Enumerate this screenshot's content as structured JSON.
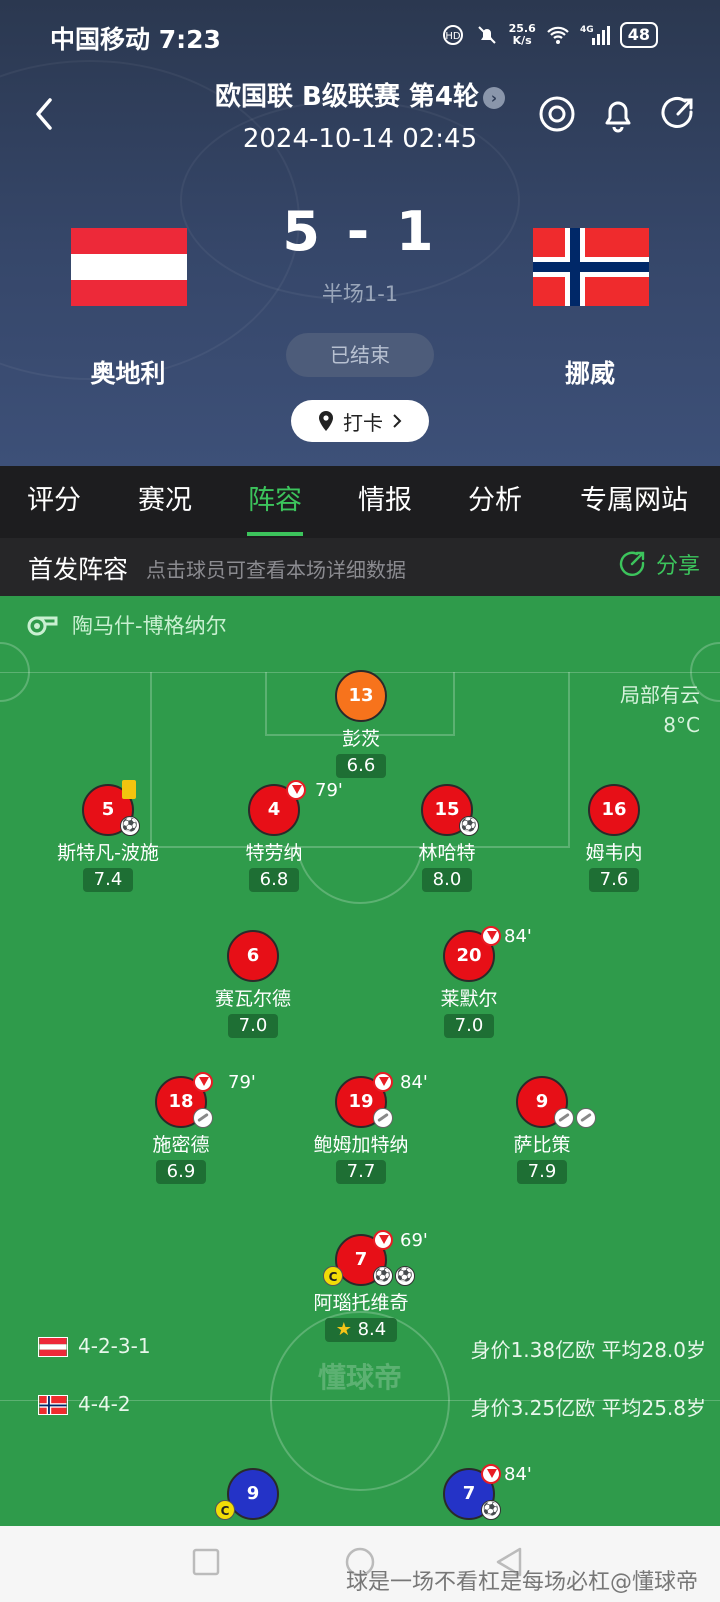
{
  "status_bar": {
    "carrier_time": "中国移动 7:23",
    "net_speed_top": "25.6",
    "net_speed_unit": "K/s",
    "network": "4G",
    "battery": "48"
  },
  "header": {
    "league": "欧国联 B级联赛 第4轮",
    "datetime": "2024-10-14 02:45",
    "score": "5 - 1",
    "halftime": "半场1-1",
    "home_team": "奥地利",
    "away_team": "挪威",
    "match_status": "已结束",
    "checkin_label": "打卡"
  },
  "tabs": [
    {
      "label": "评分"
    },
    {
      "label": "赛况"
    },
    {
      "label": "阵容",
      "active": true
    },
    {
      "label": "情报"
    },
    {
      "label": "分析"
    },
    {
      "label": "专属网站"
    }
  ],
  "lineup_bar": {
    "title": "首发阵容",
    "hint": "点击球员可查看本场详细数据",
    "share_label": "分享"
  },
  "pitch": {
    "referee": "陶马什-博格纳尔",
    "weather": "局部有云",
    "temperature": "8°C",
    "watermark": "懂球帝",
    "home_players": [
      {
        "number": "13",
        "name": "彭茨",
        "rating": "6.6"
      },
      {
        "number": "5",
        "name": "斯特凡-波施",
        "rating": "7.4"
      },
      {
        "number": "4",
        "name": "特劳纳",
        "rating": "6.8",
        "sub_time": "79'"
      },
      {
        "number": "15",
        "name": "林哈特",
        "rating": "8.0"
      },
      {
        "number": "16",
        "name": "姆韦内",
        "rating": "7.6"
      },
      {
        "number": "6",
        "name": "赛瓦尔德",
        "rating": "7.0"
      },
      {
        "number": "20",
        "name": "莱默尔",
        "rating": "7.0",
        "sub_time": "84'"
      },
      {
        "number": "18",
        "name": "施密德",
        "rating": "6.9",
        "sub_time": "79'"
      },
      {
        "number": "19",
        "name": "鲍姆加特纳",
        "rating": "7.7",
        "sub_time": "84'"
      },
      {
        "number": "9",
        "name": "萨比策",
        "rating": "7.9"
      },
      {
        "number": "7",
        "name": "阿瑙托维奇",
        "rating": "8.4",
        "sub_time": "69'"
      }
    ],
    "home_formation": {
      "formation": "4-2-3-1",
      "stats": "身价1.38亿欧   平均28.0岁"
    },
    "away_formation": {
      "formation": "4-4-2",
      "stats": "身价3.25亿欧   平均25.8岁"
    },
    "away_players": [
      {
        "number": "9"
      },
      {
        "number": "7",
        "sub_time": "84'"
      }
    ]
  },
  "nav": {
    "caption": "球是一场不看杠是每场必杠@懂球帝"
  },
  "colors": {
    "accent": "#3cc45c",
    "home": "#e70f17",
    "away": "#2433c7",
    "goalkeeper": "#f7731c",
    "pitch": "#2f9b4b"
  }
}
